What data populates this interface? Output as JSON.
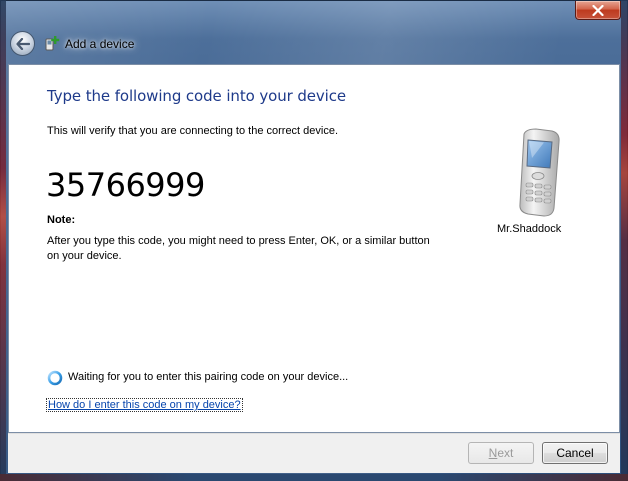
{
  "window": {
    "title": "Add a device",
    "close_glyph": "✕"
  },
  "content": {
    "heading": "Type the following code into your device",
    "subtitle": "This will verify that you are connecting to the correct device.",
    "pairing_code": "35766999",
    "note_label": "Note:",
    "note_text": "After you type this code, you might need to press Enter, OK, or a similar button on your device.",
    "device": {
      "name": "Mr.Shaddock",
      "icon": "mobile-phone-icon"
    },
    "status": {
      "icon": "busy-spinner-icon",
      "text": "Waiting for you to enter this pairing code on your device..."
    },
    "help_link": "How do I enter this code on my device?"
  },
  "footer": {
    "next_label_prefix": "",
    "next_label_mnemonic": "N",
    "next_label_rest": "ext",
    "cancel_label": "Cancel"
  },
  "colors": {
    "heading": "#1e3a8a",
    "link": "#0645ad",
    "close_button": "#c7523a"
  }
}
